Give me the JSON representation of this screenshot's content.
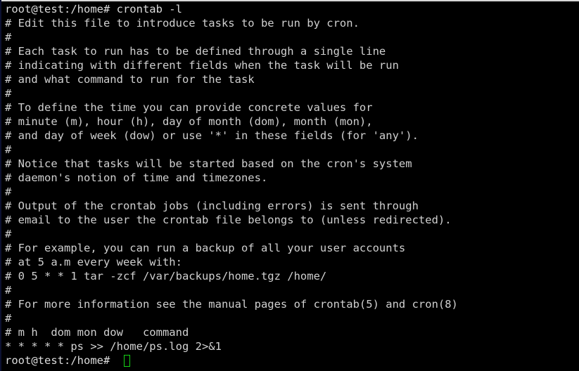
{
  "terminal": {
    "colors": {
      "background": "#000000",
      "foreground": "#d3d3d3",
      "prompt": "#dcdcdc",
      "cursor": "#16d316",
      "top_edge": "#d8d8d8",
      "left_edge": "#0b1030"
    },
    "command_prompt": "root@test:/home#",
    "command_entered": "crontab -l",
    "first_line": "root@test:/home# crontab -l",
    "final_prompt": "root@test:/home# ",
    "cursor": {
      "name": "block-cursor",
      "style": "hollow-block",
      "color": "#16d316"
    },
    "lines": [
      "# Edit this file to introduce tasks to be run by cron.",
      "#",
      "# Each task to run has to be defined through a single line",
      "# indicating with different fields when the task will be run",
      "# and what command to run for the task",
      "#",
      "# To define the time you can provide concrete values for",
      "# minute (m), hour (h), day of month (dom), month (mon),",
      "# and day of week (dow) or use '*' in these fields (for 'any').",
      "#",
      "# Notice that tasks will be started based on the cron's system",
      "# daemon's notion of time and timezones.",
      "#",
      "# Output of the crontab jobs (including errors) is sent through",
      "# email to the user the crontab file belongs to (unless redirected).",
      "#",
      "# For example, you can run a backup of all your user accounts",
      "# at 5 a.m every week with:",
      "# 0 5 * * 1 tar -zcf /var/backups/home.tgz /home/",
      "#",
      "# For more information see the manual pages of crontab(5) and cron(8)",
      "#",
      "# m h  dom mon dow   command",
      "* * * * * ps >> /home/ps.log 2>&1"
    ],
    "line_types": [
      "comment",
      "comment",
      "comment",
      "comment",
      "comment",
      "comment",
      "comment",
      "comment",
      "comment",
      "comment",
      "comment",
      "comment",
      "comment",
      "comment",
      "comment",
      "comment",
      "comment",
      "comment",
      "comment",
      "comment",
      "comment",
      "comment",
      "comment",
      "job"
    ]
  }
}
